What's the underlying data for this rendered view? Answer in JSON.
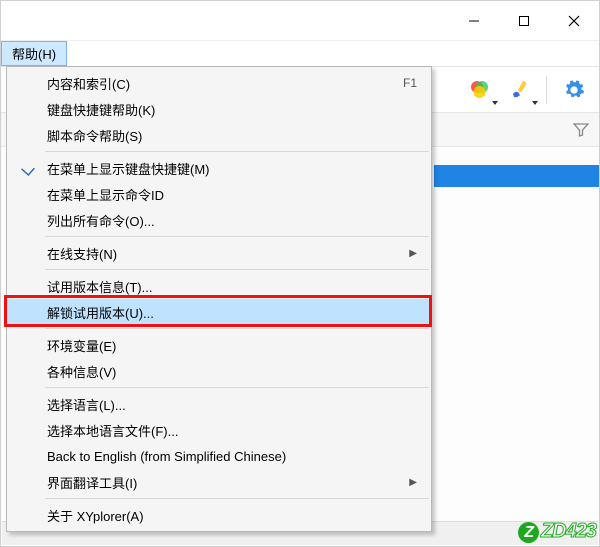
{
  "window_controls": {
    "min": "–",
    "max": "□",
    "close": "✕"
  },
  "menubar": {
    "help": "帮助(H)"
  },
  "menu": {
    "items": [
      {
        "label": "内容和索引(C)",
        "shortcut": "F1"
      },
      {
        "label": "键盘快捷键帮助(K)",
        "shortcut": ""
      },
      {
        "label": "脚本命令帮助(S)",
        "shortcut": ""
      },
      {
        "sep": true
      },
      {
        "label": "在菜单上显示键盘快捷键(M)",
        "checked": true
      },
      {
        "label": "在菜单上显示命令ID",
        "shortcut": ""
      },
      {
        "label": "列出所有命令(O)...",
        "shortcut": ""
      },
      {
        "sep": true
      },
      {
        "label": "在线支持(N)",
        "submenu": true
      },
      {
        "sep": true
      },
      {
        "label": "试用版本信息(T)...",
        "shortcut": ""
      },
      {
        "label": "解锁试用版本(U)...",
        "highlight": true
      },
      {
        "sep": true
      },
      {
        "label": "环境变量(E)",
        "shortcut": ""
      },
      {
        "label": "各种信息(V)",
        "shortcut": ""
      },
      {
        "sep": true
      },
      {
        "label": "选择语言(L)...",
        "shortcut": ""
      },
      {
        "label": "选择本地语言文件(F)...",
        "shortcut": ""
      },
      {
        "label": "Back to English (from Simplified Chinese)",
        "shortcut": ""
      },
      {
        "label": "界面翻译工具(I)",
        "submenu": true
      },
      {
        "sep": true
      },
      {
        "label": "关于 XYplorer(A)",
        "shortcut": ""
      }
    ]
  },
  "toolbar_icons": {
    "colorfilter": "color-filter-icon",
    "brush": "brush-icon",
    "gear": "settings-icon"
  },
  "filter_icon": "funnel-icon",
  "statusbar": "",
  "watermark": "ZD423"
}
